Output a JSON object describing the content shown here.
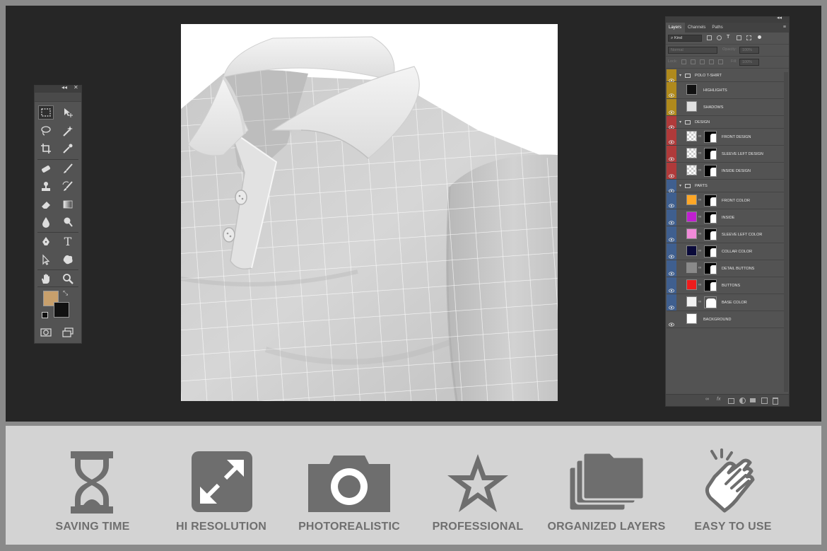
{
  "colors": {
    "workspace": "#262626",
    "panel": "#535353",
    "feature_icon": "#6e6e6e",
    "feature_label": "#6f6f6f",
    "foreground_swatch": "#c8a06c",
    "background_swatch": "#111111"
  },
  "tools_panel": {
    "collapse_glyph": "◂◂",
    "close_glyph": "✕",
    "tools": [
      "rectangular-marquee",
      "move",
      "lasso",
      "magic-wand",
      "crop",
      "eyedropper",
      "spot-healing",
      "brush",
      "clone-stamp",
      "history-brush",
      "eraser",
      "gradient",
      "blur",
      "dodge",
      "pen",
      "type",
      "path-selection",
      "custom-shape",
      "hand",
      "zoom"
    ],
    "type_glyph": "T"
  },
  "canvas": {
    "subject": "polo shirt mockup with grid overlay"
  },
  "layers_panel": {
    "collapse_glyph": "◂◂",
    "close_glyph": "✕",
    "tabs": [
      "Layers",
      "Channels",
      "Paths"
    ],
    "menu_glyph": "≡",
    "filter_kind": "Kind",
    "blend_mode": "Normal",
    "opacity_label": "Opacity:",
    "opacity_value": "100%",
    "lock_label": "Lock:",
    "fill_label": "Fill:",
    "fill_value": "100%",
    "layers": [
      {
        "name": "POLO T-SHIRT",
        "kind": "group",
        "tag": "#b08a1c"
      },
      {
        "name": "HIGHLIGHTS",
        "kind": "layer",
        "tag": "#b08a1c",
        "thumb": "#111111"
      },
      {
        "name": "SHADOWS",
        "kind": "layer",
        "tag": "#b08a1c",
        "thumb": "#e0e0e0"
      },
      {
        "name": "DESIGN",
        "kind": "group",
        "tag": "#b03a3a"
      },
      {
        "name": "FRONT DESIGN",
        "kind": "smart",
        "tag": "#b03a3a"
      },
      {
        "name": "SLEEVE LEFT DESIGN",
        "kind": "smart",
        "tag": "#b03a3a"
      },
      {
        "name": "INSIDE DESIGN",
        "kind": "smart",
        "tag": "#b03a3a"
      },
      {
        "name": "PARTS",
        "kind": "group",
        "tag": "#3f5f8f"
      },
      {
        "name": "FRONT COLOR",
        "kind": "fill",
        "tag": "#3f5f8f",
        "swatch": "#ffa726"
      },
      {
        "name": "INSIDE",
        "kind": "fill",
        "tag": "#3f5f8f",
        "swatch": "#c01fd0"
      },
      {
        "name": "SLEEVE LEFT COLOR",
        "kind": "fill",
        "tag": "#3f5f8f",
        "swatch": "#f08ad8"
      },
      {
        "name": "COLLAR COLOR",
        "kind": "fill",
        "tag": "#3f5f8f",
        "swatch": "#0a0a3a"
      },
      {
        "name": "DETAIL BUTTONS",
        "kind": "fill",
        "tag": "#3f5f8f",
        "swatch": "#8a8a8a"
      },
      {
        "name": "BUTTONS",
        "kind": "fill",
        "tag": "#3f5f8f",
        "swatch": "#ee1c1c"
      },
      {
        "name": "BASE COLOR",
        "kind": "fill",
        "tag": "#3f5f8f",
        "swatch": "#f2f2f2"
      },
      {
        "name": "BACKGROUND",
        "kind": "layer",
        "tag": "",
        "thumb": "#ffffff"
      }
    ],
    "footer_icons": [
      "link-icon",
      "fx-icon",
      "mask-icon",
      "adjustment-icon",
      "group-icon",
      "new-layer-icon",
      "trash-icon"
    ],
    "footer_glyphs": [
      "∞",
      "fx"
    ]
  },
  "features": [
    {
      "label": "SAVING TIME",
      "icon": "hourglass-icon"
    },
    {
      "label": "HI RESOLUTION",
      "icon": "expand-arrows-icon"
    },
    {
      "label": "PHOTOREALISTIC",
      "icon": "camera-icon"
    },
    {
      "label": "PROFESSIONAL",
      "icon": "star-icon"
    },
    {
      "label": "ORGANIZED LAYERS",
      "icon": "folders-icon"
    },
    {
      "label": "EASY TO USE",
      "icon": "tap-hand-icon"
    }
  ]
}
